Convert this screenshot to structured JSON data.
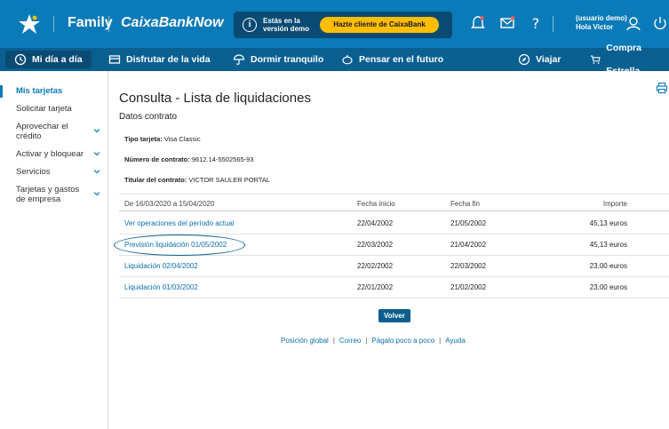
{
  "topbar": {
    "brand_family": "Family",
    "brand_now": "CaixaBankNow",
    "demo_text": "Estás en la versión demo",
    "demo_cta": "Hazte cliente de CaixaBank",
    "user_line1": "(usuario demo)",
    "user_line2": "Hola Victor",
    "icons": [
      "caixa-star-logo",
      "bell-icon",
      "mail-icon",
      "help-icon",
      "user-icon",
      "power-icon"
    ]
  },
  "nav": {
    "items": [
      {
        "label": "Mi día a día",
        "icon": "clock-icon"
      },
      {
        "label": "Disfrutar de la vida",
        "icon": "card-icon"
      },
      {
        "label": "Dormir tranquilo",
        "icon": "umbrella-icon"
      },
      {
        "label": "Pensar en el futuro",
        "icon": "piggy-icon"
      },
      {
        "label": "Viajar",
        "icon": "compass-icon"
      },
      {
        "label": "Compra Estrella",
        "icon": "cart-icon"
      }
    ]
  },
  "sidebar": {
    "items": [
      {
        "label": "Mis tarjetas",
        "active": true,
        "expandable": false
      },
      {
        "label": "Solicitar tarjeta",
        "active": false,
        "expandable": false
      },
      {
        "label": "Aprovechar el crédito",
        "active": false,
        "expandable": true
      },
      {
        "label": "Activar y bloquear",
        "active": false,
        "expandable": true
      },
      {
        "label": "Servicios",
        "active": false,
        "expandable": true
      },
      {
        "label": "Tarjetas y gastos de empresa",
        "active": false,
        "expandable": true
      }
    ]
  },
  "main": {
    "title": "Consulta - Lista de liquidaciones",
    "subhead": "Datos contrato",
    "fields": [
      {
        "label": "Tipo tarjeta:",
        "value": "Visa Classic"
      },
      {
        "label": "Número de contrato:",
        "value": "9612.14-5502565-93"
      },
      {
        "label": "Titular del contrato:",
        "value": "VICTOR SAULER PORTAL"
      }
    ],
    "table": {
      "headers": [
        "De 16/03/2020 a 15/04/2020",
        "Fecha inicio",
        "Fecha fin",
        "Importe"
      ],
      "rows": [
        [
          "Ver operaciones del período actual",
          "22/04/2002",
          "21/05/2002",
          "45,13 euros"
        ],
        [
          "Previsión liquidación 01/05/2002",
          "22/03/2002",
          "21/04/2002",
          "45,13 euros"
        ],
        [
          "Liquidación 02/04/2002",
          "22/02/2002",
          "22/03/2002",
          "23,00 euros"
        ],
        [
          "Liquidación 01/03/2002",
          "22/01/2002",
          "21/02/2002",
          "23,00 euros"
        ]
      ]
    },
    "back_button": "Volver",
    "footer_links": [
      "Posición global",
      "Correo",
      "Págalo poco a poco",
      "Ayuda"
    ]
  },
  "colors": {
    "topbar": "#0b7ab8",
    "navbar": "#0a5f91",
    "cta": "#ffbe00",
    "link": "#0b6fae"
  }
}
